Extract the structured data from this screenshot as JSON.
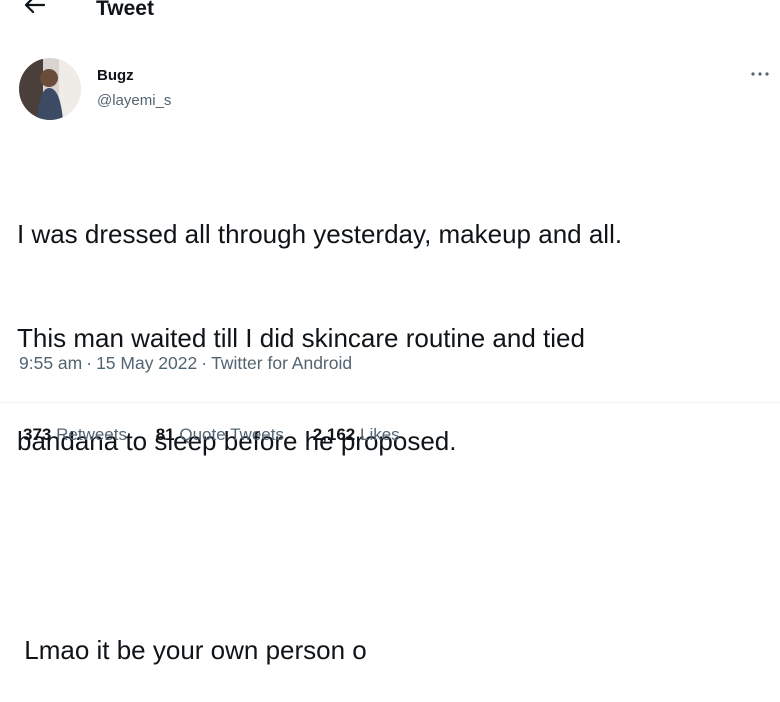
{
  "header": {
    "title": "Tweet",
    "back_icon": "arrow-left-icon"
  },
  "author": {
    "display_name": "Bugz",
    "handle": "@layemi_s",
    "avatar_icon": "avatar",
    "more_icon": "more-horizontal-icon"
  },
  "tweet": {
    "lines": [
      "I was dressed all through yesterday, makeup and all.",
      "This man waited till I did skincare routine and tied",
      "bandana to sleep before he proposed.",
      "",
      " Lmao it be your own person o"
    ],
    "time": "9:55 am",
    "separator": "·",
    "date": "15 May 2022",
    "source": "Twitter for Android"
  },
  "stats": {
    "retweets_count": "373",
    "retweets_label": "Retweets",
    "quotes_count": "81",
    "quotes_label": "Quote Tweets",
    "likes_count": "2,162",
    "likes_label": "Likes"
  },
  "colors": {
    "text": "#0f1419",
    "secondary": "#536471",
    "divider": "#eff3f4"
  }
}
